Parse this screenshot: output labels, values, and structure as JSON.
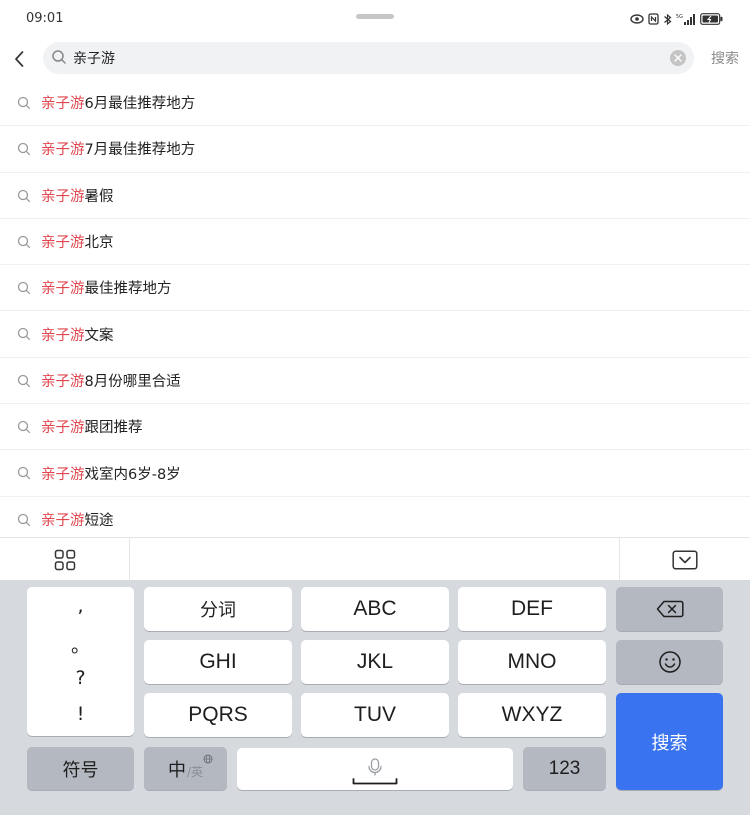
{
  "status_bar": {
    "time": "09:01"
  },
  "search": {
    "query": "亲子游",
    "button_label": "搜索"
  },
  "suggestions": [
    {
      "highlight": "亲子游",
      "rest": "6月最佳推荐地方"
    },
    {
      "highlight": "亲子游",
      "rest": "7月最佳推荐地方"
    },
    {
      "highlight": "亲子游",
      "rest": "暑假"
    },
    {
      "highlight": "亲子游",
      "rest": "北京"
    },
    {
      "highlight": "亲子游",
      "rest": "最佳推荐地方"
    },
    {
      "highlight": "亲子游",
      "rest": "文案"
    },
    {
      "highlight": "亲子游",
      "rest": "8月份哪里合适"
    },
    {
      "highlight": "亲子游",
      "rest": "跟团推荐"
    },
    {
      "highlight": "亲子游",
      "rest": "戏室内6岁-8岁"
    },
    {
      "highlight": "亲子游",
      "rest": "短途"
    }
  ],
  "colors": {
    "highlight": "#e2474f",
    "enter_key": "#3a73ef",
    "keyboard_bg": "#d6d9de"
  },
  "keyboard": {
    "punctuation": [
      ",",
      "。",
      "?",
      "!"
    ],
    "row1": [
      "分词",
      "ABC",
      "DEF"
    ],
    "row2": [
      "GHI",
      "JKL",
      "MNO"
    ],
    "row3": [
      "PQRS",
      "TUV",
      "WXYZ"
    ],
    "symbols_label": "符号",
    "lang_main": "中",
    "lang_sub": "/英",
    "numbers_label": "123",
    "enter_label": "搜索"
  }
}
